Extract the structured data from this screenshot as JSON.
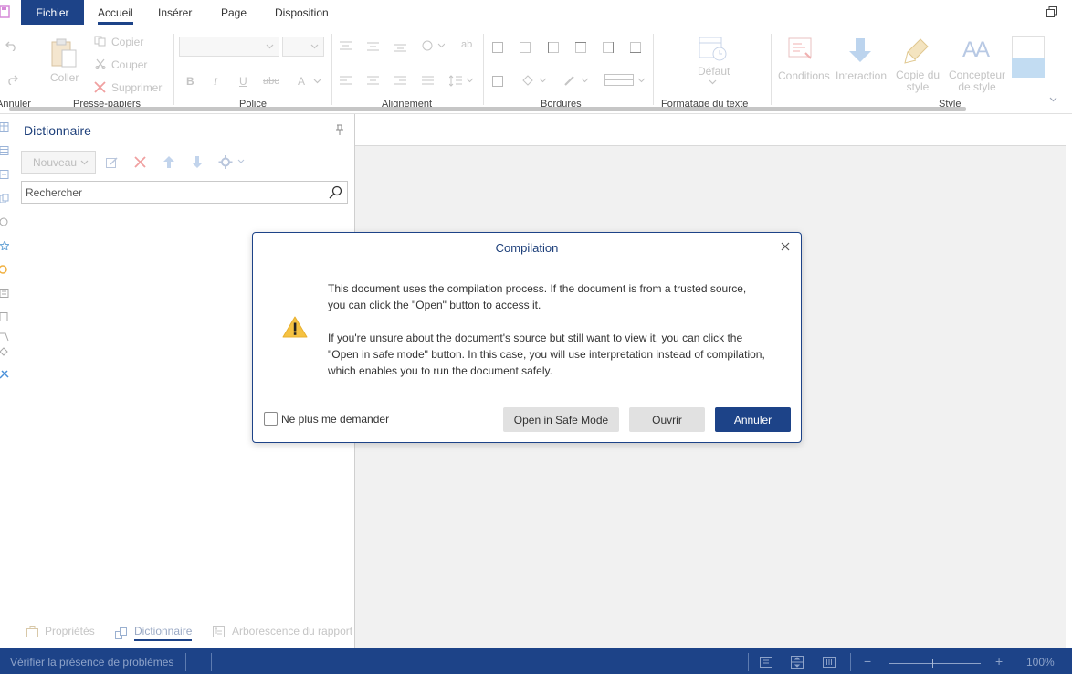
{
  "tabs": {
    "fichier": "Fichier",
    "accueil": "Accueil",
    "inserer": "Insérer",
    "page": "Page",
    "disposition": "Disposition"
  },
  "ribbon": {
    "groups": {
      "annuler": "Annuler",
      "presse_papiers": "Presse-papiers",
      "police": "Police",
      "alignement": "Alignement",
      "bordures": "Bordures",
      "formatage_texte": "Formatage du texte",
      "style": "Style"
    },
    "coller": "Coller",
    "copier": "Copier",
    "couper": "Couper",
    "supprimer": "Supprimer",
    "defaut": "Défaut",
    "conditions": "Conditions",
    "interaction": "Interaction",
    "copie_du_style_1": "Copie du",
    "copie_du_style_2": "style",
    "concepteur_1": "Concepteur",
    "concepteur_2": "de style"
  },
  "dictionary": {
    "title": "Dictionnaire",
    "nouveau": "Nouveau",
    "search_placeholder": "Rechercher",
    "footer": {
      "proprietes": "Propriétés",
      "dictionnaire": "Dictionnaire",
      "arborescence": "Arborescence du rapport"
    }
  },
  "modal": {
    "title": "Compilation",
    "message_1": "This document uses the compilation process. If the document is from a trusted source, you can click the \"Open\" button to access it.",
    "message_2": "If you're unsure about the document's source but still want to view it, you can click the \"Open in safe mode\" button. In this case, you will use interpretation instead of compilation, which enables you to run the document safely.",
    "checkbox_label": "Ne plus me demander",
    "checkbox_checked": false,
    "btn_safe": "Open in Safe Mode",
    "btn_open": "Ouvrir",
    "btn_cancel": "Annuler"
  },
  "status": {
    "check": "Vérifier la présence de problèmes",
    "zoom_minus": "−",
    "zoom_plus": "+",
    "zoom": "100%"
  },
  "colors": {
    "accent": "#1d4388",
    "warning": "#f5c242"
  }
}
